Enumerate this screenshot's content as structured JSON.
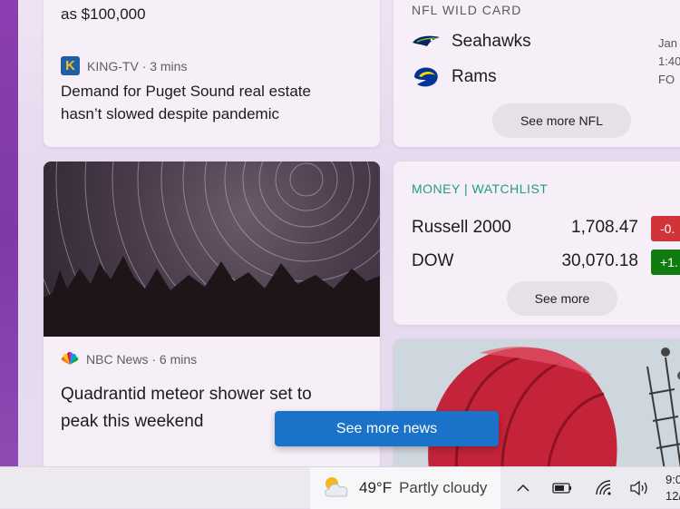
{
  "news": {
    "article1": {
      "previous_title_fragment": "as $100,000",
      "source": "KING-TV · 3 mins",
      "headline_line1": "Demand for Puget Sound real estate",
      "headline_line2": "hasn’t slowed despite pandemic"
    },
    "article2": {
      "source": "NBC News · 6 mins",
      "headline_line1": "Quadrantid meteor shower set to",
      "headline_line2": "peak this weekend"
    },
    "see_more_news_label": "See more news"
  },
  "nfl": {
    "label": "NFL WILD CARD",
    "teams": [
      {
        "name": "Seahawks",
        "info": "Jan"
      },
      {
        "name": "Rams",
        "info": "1:40"
      }
    ],
    "extra_info": "FO",
    "see_more_label": "See more NFL"
  },
  "money": {
    "label": "MONEY | WATCHLIST",
    "stocks": [
      {
        "name": "Russell 2000",
        "value": "1,708.47",
        "change": "-0.",
        "color": "#d13438"
      },
      {
        "name": "DOW",
        "value": "30,070.18",
        "change": "+1.",
        "color": "#107c10"
      }
    ],
    "see_more_label": "See more"
  },
  "taskbar": {
    "temperature": "49°F",
    "condition": "Partly cloudy",
    "time": "9:0",
    "date": "12/"
  },
  "colors": {
    "accent": "#1a72c9",
    "money_green": "#1f9c87",
    "loss": "#d13438",
    "gain": "#107c10"
  }
}
